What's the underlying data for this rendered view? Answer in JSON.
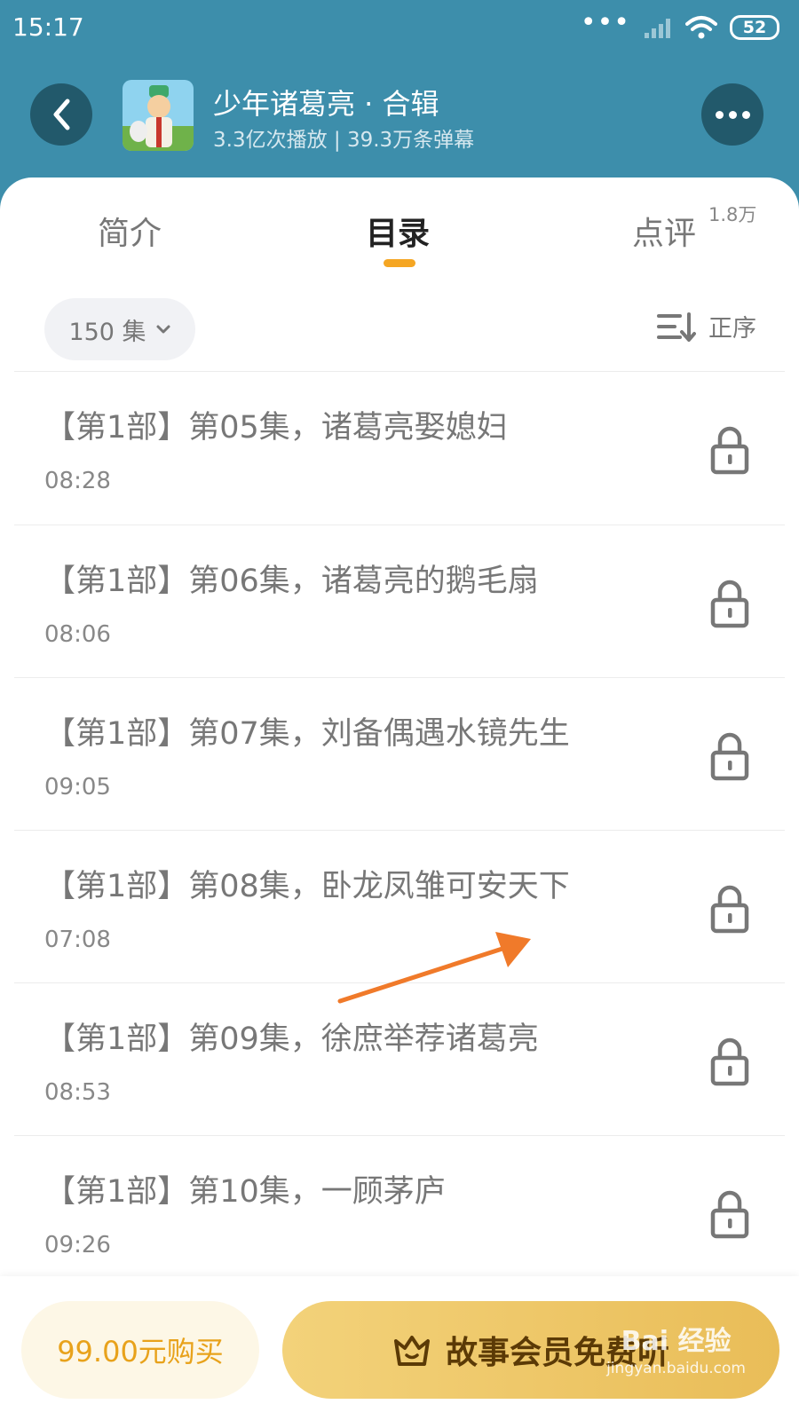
{
  "status_bar": {
    "time": "15:17",
    "dots": "•••",
    "battery": "52"
  },
  "header": {
    "title": "少年诸葛亮 · 合辑",
    "subtitle": "3.3亿次播放 | 39.3万条弹幕"
  },
  "tabs": [
    {
      "label": "简介"
    },
    {
      "label": "目录"
    },
    {
      "label": "点评",
      "badge": "1.8万"
    }
  ],
  "filter": {
    "episodes_label": "150 集",
    "sort_label": "正序"
  },
  "episodes": [
    {
      "title": "【第1部】第05集，诸葛亮娶媳妇",
      "duration": "08:28"
    },
    {
      "title": "【第1部】第06集，诸葛亮的鹅毛扇",
      "duration": "08:06"
    },
    {
      "title": "【第1部】第07集，刘备偶遇水镜先生",
      "duration": "09:05"
    },
    {
      "title": "【第1部】第08集，卧龙凤雏可安天下",
      "duration": "07:08"
    },
    {
      "title": "【第1部】第09集，徐庶举荐诸葛亮",
      "duration": "08:53"
    },
    {
      "title": "【第1部】第10集，一顾茅庐",
      "duration": "09:26"
    }
  ],
  "bottom": {
    "buy_label": "99.00元购买",
    "member_label": "故事会员免费听"
  },
  "watermark": {
    "brand": "Bai 经验",
    "url": "jingyan.baidu.com"
  },
  "colors": {
    "header_bg": "#3d8eab",
    "accent": "#f5a623",
    "buy_text": "#e8a21b",
    "member_bg": "#e9bd58",
    "annotation_arrow": "#f07a2a"
  }
}
